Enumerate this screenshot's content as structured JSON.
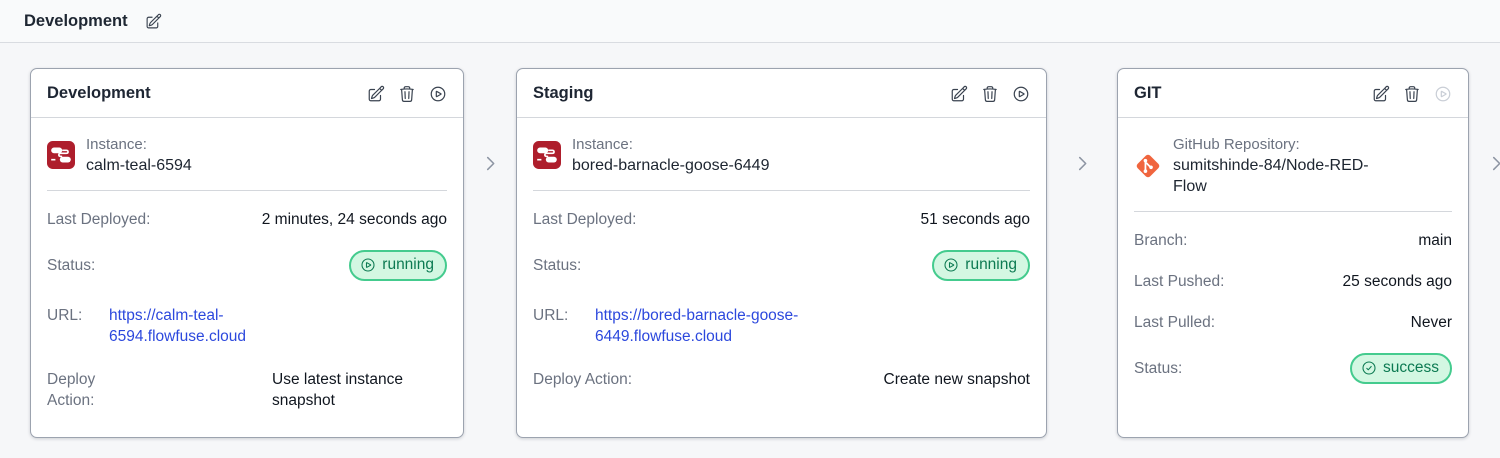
{
  "topbar": {
    "title": "Development"
  },
  "pipeline": {
    "stages": [
      {
        "title": "Development",
        "instance": {
          "label": "Instance:",
          "name": "calm-teal-6594"
        },
        "last_deployed": {
          "label": "Last Deployed:",
          "value": "2 minutes, 24 seconds ago"
        },
        "status": {
          "label": "Status:",
          "value": "running"
        },
        "url": {
          "label": "URL:",
          "value": "https://calm-teal-6594.flowfuse.cloud"
        },
        "deploy_action": {
          "label": "Deploy Action:",
          "value": "Use latest instance snapshot"
        }
      },
      {
        "title": "Staging",
        "instance": {
          "label": "Instance:",
          "name": "bored-barnacle-goose-6449"
        },
        "last_deployed": {
          "label": "Last Deployed:",
          "value": "51 seconds ago"
        },
        "status": {
          "label": "Status:",
          "value": "running"
        },
        "url": {
          "label": "URL:",
          "value": "https://bored-barnacle-goose-6449.flowfuse.cloud"
        },
        "deploy_action": {
          "label": "Deploy Action:",
          "value": "Create new snapshot"
        }
      },
      {
        "title": "GIT",
        "repository": {
          "label": "GitHub Repository:",
          "name": "sumitshinde-84/Node-RED-Flow"
        },
        "branch": {
          "label": "Branch:",
          "value": "main"
        },
        "last_pushed": {
          "label": "Last Pushed:",
          "value": "25 seconds ago"
        },
        "last_pulled": {
          "label": "Last Pulled:",
          "value": "Never"
        },
        "status": {
          "label": "Status:",
          "value": "success"
        }
      }
    ]
  },
  "icons": {
    "topbar": "edit-icon",
    "card_actions": [
      "edit-icon",
      "trash-icon",
      "play-circle-icon"
    ],
    "running_badge": "play-circle-icon",
    "success_badge": "check-circle-icon",
    "stage_connector": "chevron-right-icon",
    "instance": "node-red-icon",
    "repository": "git-icon"
  },
  "colors": {
    "accent_green_bg": "#d3f7e2",
    "accent_green_border": "#44cb8e",
    "accent_green_text": "#0c7a52",
    "link_blue": "#2c48dd",
    "node_red": "#ae1e2c",
    "git_orange": "#f0653e",
    "disabled_icon": "#c9ced6"
  }
}
